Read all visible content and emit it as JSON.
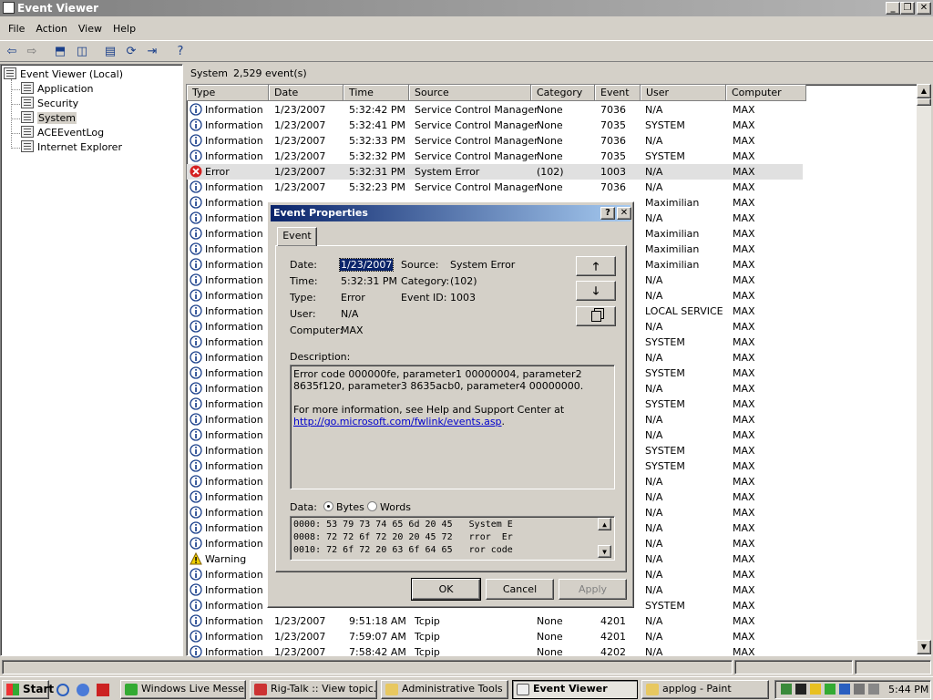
{
  "window": {
    "title": "Event Viewer"
  },
  "menu": [
    "File",
    "Action",
    "View",
    "Help"
  ],
  "tree": {
    "root": "Event Viewer (Local)",
    "items": [
      "Application",
      "Security",
      "System",
      "ACEEventLog",
      "Internet Explorer"
    ],
    "selected": "System"
  },
  "list_header": {
    "name": "System",
    "count": "2,529 event(s)"
  },
  "columns": [
    "Type",
    "Date",
    "Time",
    "Source",
    "Category",
    "Event",
    "User",
    "Computer"
  ],
  "rows": [
    {
      "type": "Information",
      "date": "1/23/2007",
      "time": "5:32:42 PM",
      "source": "Service Control Manager",
      "category": "None",
      "event": "7036",
      "user": "N/A",
      "computer": "MAX"
    },
    {
      "type": "Information",
      "date": "1/23/2007",
      "time": "5:32:41 PM",
      "source": "Service Control Manager",
      "category": "None",
      "event": "7035",
      "user": "SYSTEM",
      "computer": "MAX"
    },
    {
      "type": "Information",
      "date": "1/23/2007",
      "time": "5:32:33 PM",
      "source": "Service Control Manager",
      "category": "None",
      "event": "7036",
      "user": "N/A",
      "computer": "MAX"
    },
    {
      "type": "Information",
      "date": "1/23/2007",
      "time": "5:32:32 PM",
      "source": "Service Control Manager",
      "category": "None",
      "event": "7035",
      "user": "SYSTEM",
      "computer": "MAX"
    },
    {
      "type": "Error",
      "date": "1/23/2007",
      "time": "5:32:31 PM",
      "source": "System Error",
      "category": "(102)",
      "event": "1003",
      "user": "N/A",
      "computer": "MAX"
    },
    {
      "type": "Information",
      "date": "1/23/2007",
      "time": "5:32:23 PM",
      "source": "Service Control Manager",
      "category": "None",
      "event": "7036",
      "user": "N/A",
      "computer": "MAX"
    },
    {
      "type": "Information",
      "date": "",
      "time": "",
      "source": "",
      "category": "",
      "event": "",
      "user": "Maximilian",
      "computer": "MAX"
    },
    {
      "type": "Information",
      "date": "",
      "time": "",
      "source": "",
      "category": "",
      "event": "",
      "user": "N/A",
      "computer": "MAX"
    },
    {
      "type": "Information",
      "date": "",
      "time": "",
      "source": "",
      "category": "",
      "event": "",
      "user": "Maximilian",
      "computer": "MAX"
    },
    {
      "type": "Information",
      "date": "",
      "time": "",
      "source": "",
      "category": "",
      "event": "",
      "user": "Maximilian",
      "computer": "MAX"
    },
    {
      "type": "Information",
      "date": "",
      "time": "",
      "source": "",
      "category": "",
      "event": "",
      "user": "Maximilian",
      "computer": "MAX"
    },
    {
      "type": "Information",
      "date": "",
      "time": "",
      "source": "",
      "category": "",
      "event": "",
      "user": "N/A",
      "computer": "MAX"
    },
    {
      "type": "Information",
      "date": "",
      "time": "",
      "source": "",
      "category": "",
      "event": "",
      "user": "N/A",
      "computer": "MAX"
    },
    {
      "type": "Information",
      "date": "",
      "time": "",
      "source": "",
      "category": "",
      "event": "",
      "user": "LOCAL SERVICE",
      "computer": "MAX"
    },
    {
      "type": "Information",
      "date": "",
      "time": "",
      "source": "",
      "category": "",
      "event": "",
      "user": "N/A",
      "computer": "MAX"
    },
    {
      "type": "Information",
      "date": "",
      "time": "",
      "source": "",
      "category": "",
      "event": "",
      "user": "SYSTEM",
      "computer": "MAX"
    },
    {
      "type": "Information",
      "date": "",
      "time": "",
      "source": "",
      "category": "",
      "event": "",
      "user": "N/A",
      "computer": "MAX"
    },
    {
      "type": "Information",
      "date": "",
      "time": "",
      "source": "",
      "category": "",
      "event": "",
      "user": "SYSTEM",
      "computer": "MAX"
    },
    {
      "type": "Information",
      "date": "",
      "time": "",
      "source": "",
      "category": "",
      "event": "",
      "user": "N/A",
      "computer": "MAX"
    },
    {
      "type": "Information",
      "date": "",
      "time": "",
      "source": "",
      "category": "",
      "event": "",
      "user": "SYSTEM",
      "computer": "MAX"
    },
    {
      "type": "Information",
      "date": "",
      "time": "",
      "source": "",
      "category": "",
      "event": "",
      "user": "N/A",
      "computer": "MAX"
    },
    {
      "type": "Information",
      "date": "",
      "time": "",
      "source": "",
      "category": "",
      "event": "",
      "user": "N/A",
      "computer": "MAX"
    },
    {
      "type": "Information",
      "date": "",
      "time": "",
      "source": "",
      "category": "",
      "event": "",
      "user": "SYSTEM",
      "computer": "MAX"
    },
    {
      "type": "Information",
      "date": "",
      "time": "",
      "source": "",
      "category": "",
      "event": "",
      "user": "SYSTEM",
      "computer": "MAX"
    },
    {
      "type": "Information",
      "date": "",
      "time": "",
      "source": "",
      "category": "",
      "event": "",
      "user": "N/A",
      "computer": "MAX"
    },
    {
      "type": "Information",
      "date": "",
      "time": "",
      "source": "",
      "category": "",
      "event": "",
      "user": "N/A",
      "computer": "MAX"
    },
    {
      "type": "Information",
      "date": "",
      "time": "",
      "source": "",
      "category": "",
      "event": "",
      "user": "N/A",
      "computer": "MAX"
    },
    {
      "type": "Information",
      "date": "",
      "time": "",
      "source": "",
      "category": "",
      "event": "",
      "user": "N/A",
      "computer": "MAX"
    },
    {
      "type": "Information",
      "date": "",
      "time": "",
      "source": "",
      "category": "",
      "event": "",
      "user": "N/A",
      "computer": "MAX"
    },
    {
      "type": "Warning",
      "date": "",
      "time": "",
      "source": "",
      "category": "",
      "event": "",
      "user": "N/A",
      "computer": "MAX"
    },
    {
      "type": "Information",
      "date": "",
      "time": "",
      "source": "",
      "category": "",
      "event": "",
      "user": "N/A",
      "computer": "MAX"
    },
    {
      "type": "Information",
      "date": "",
      "time": "",
      "source": "",
      "category": "",
      "event": "",
      "user": "N/A",
      "computer": "MAX"
    },
    {
      "type": "Information",
      "date": "",
      "time": "",
      "source": "",
      "category": "",
      "event": "",
      "user": "SYSTEM",
      "computer": "MAX"
    },
    {
      "type": "Information",
      "date": "1/23/2007",
      "time": "9:51:18 AM",
      "source": "Tcpip",
      "category": "None",
      "event": "4201",
      "user": "N/A",
      "computer": "MAX"
    },
    {
      "type": "Information",
      "date": "1/23/2007",
      "time": "7:59:07 AM",
      "source": "Tcpip",
      "category": "None",
      "event": "4201",
      "user": "N/A",
      "computer": "MAX"
    },
    {
      "type": "Information",
      "date": "1/23/2007",
      "time": "7:58:42 AM",
      "source": "Tcpip",
      "category": "None",
      "event": "4202",
      "user": "N/A",
      "computer": "MAX"
    }
  ],
  "dialog": {
    "title": "Event Properties",
    "tab": "Event",
    "date_label": "Date:",
    "date": "1/23/2007",
    "source_label": "Source:",
    "source": "System Error",
    "time_label": "Time:",
    "time": "5:32:31 PM",
    "category_label": "Category:",
    "category": "(102)",
    "type_label": "Type:",
    "type": "Error",
    "eventid_label": "Event ID:",
    "eventid": "1003",
    "user_label": "User:",
    "user": "N/A",
    "computer_label": "Computer:",
    "computer": "MAX",
    "description_label": "Description:",
    "description_1": "Error code 000000fe, parameter1 00000004, parameter2 8635f120, parameter3 8635acb0, parameter4 00000000.",
    "description_2": "For more information, see Help and Support Center at",
    "description_link": "http://go.microsoft.com/fwlink/events.asp",
    "description_end": ".",
    "data_label": "Data:",
    "bytes_label": "Bytes",
    "words_label": "Words",
    "hex_lines": [
      "0000: 53 79 73 74 65 6d 20 45   System E",
      "0008: 72 72 6f 72 20 20 45 72   rror  Er",
      "0010: 72 6f 72 20 63 6f 64 65   ror code"
    ],
    "ok": "OK",
    "cancel": "Cancel",
    "apply": "Apply"
  },
  "taskbar": {
    "start": "Start",
    "tasks": [
      "Windows Live Messe...",
      "Rig-Talk :: View topic...",
      "Administrative Tools",
      "Event Viewer",
      "applog - Paint"
    ],
    "active": "Event Viewer",
    "clock": "5:44 PM"
  }
}
